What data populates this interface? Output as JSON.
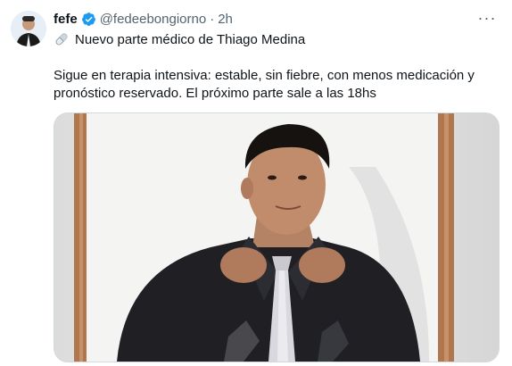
{
  "tweet": {
    "author_name": "fefe",
    "handle": "@fedeebongiorno",
    "separator": "·",
    "time": "2h",
    "more_label": "···",
    "title_emoji": "pill-icon",
    "title": "Nuevo parte médico de Thiago Medina",
    "body_line1": "Sigue en terapia intensiva: estable, sin fiebre, con menos medicación y",
    "body_line2": "pronóstico reservado. El próximo parte sale a las 18hs"
  },
  "colors": {
    "verified": "#1d9bf0",
    "text": "#0f1419",
    "secondary": "#536471",
    "border": "#cfd9de"
  }
}
